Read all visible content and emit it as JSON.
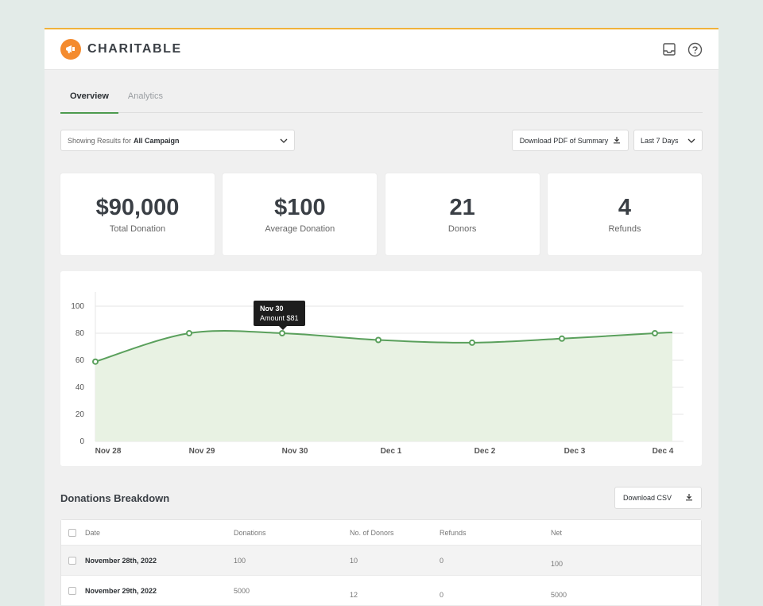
{
  "app": {
    "brand": "CHARITABLE",
    "accent": "#4c9a4e",
    "logo_color": "#f48b2e"
  },
  "header": {
    "icons": [
      "inbox-icon",
      "help-icon"
    ]
  },
  "tabs": [
    {
      "label": "Overview",
      "active": true
    },
    {
      "label": "Analytics",
      "active": false
    }
  ],
  "filters": {
    "prefix": "Showing Results for",
    "campaign": "All Campaign",
    "download_pdf_label": "Download PDF of Summary",
    "range": "Last 7 Days"
  },
  "stats": [
    {
      "value": "$90,000",
      "label": "Total Donation"
    },
    {
      "value": "$100",
      "label": "Average Donation"
    },
    {
      "value": "21",
      "label": "Donors"
    },
    {
      "value": "4",
      "label": "Refunds"
    }
  ],
  "chart_data": {
    "type": "area",
    "x": [
      "Nov 28",
      "Nov 29",
      "Nov 30",
      "Dec 1",
      "Dec 2",
      "Dec 3",
      "Dec 4"
    ],
    "series": [
      {
        "values": [
          59,
          80,
          80,
          75,
          73,
          76,
          80
        ],
        "color": "#5aa05c"
      }
    ],
    "y_ticks": [
      0,
      20,
      40,
      60,
      80,
      100
    ],
    "ylim": [
      0,
      100
    ],
    "grid": true,
    "tooltip": {
      "title": "Nov 30",
      "text": "Amount $81"
    }
  },
  "breakdown": {
    "title": "Donations Breakdown",
    "download_csv_label": "Download CSV",
    "columns": [
      "Date",
      "Donations",
      "No. of Donors",
      "Refunds",
      "Net"
    ],
    "rows": [
      {
        "date": "November 28th, 2022",
        "donations": "100",
        "donors": "10",
        "refunds": "0",
        "net": "100"
      },
      {
        "date": "November 29th, 2022",
        "donations": "5000",
        "donors": "12",
        "refunds": "0",
        "net": "5000"
      }
    ]
  }
}
